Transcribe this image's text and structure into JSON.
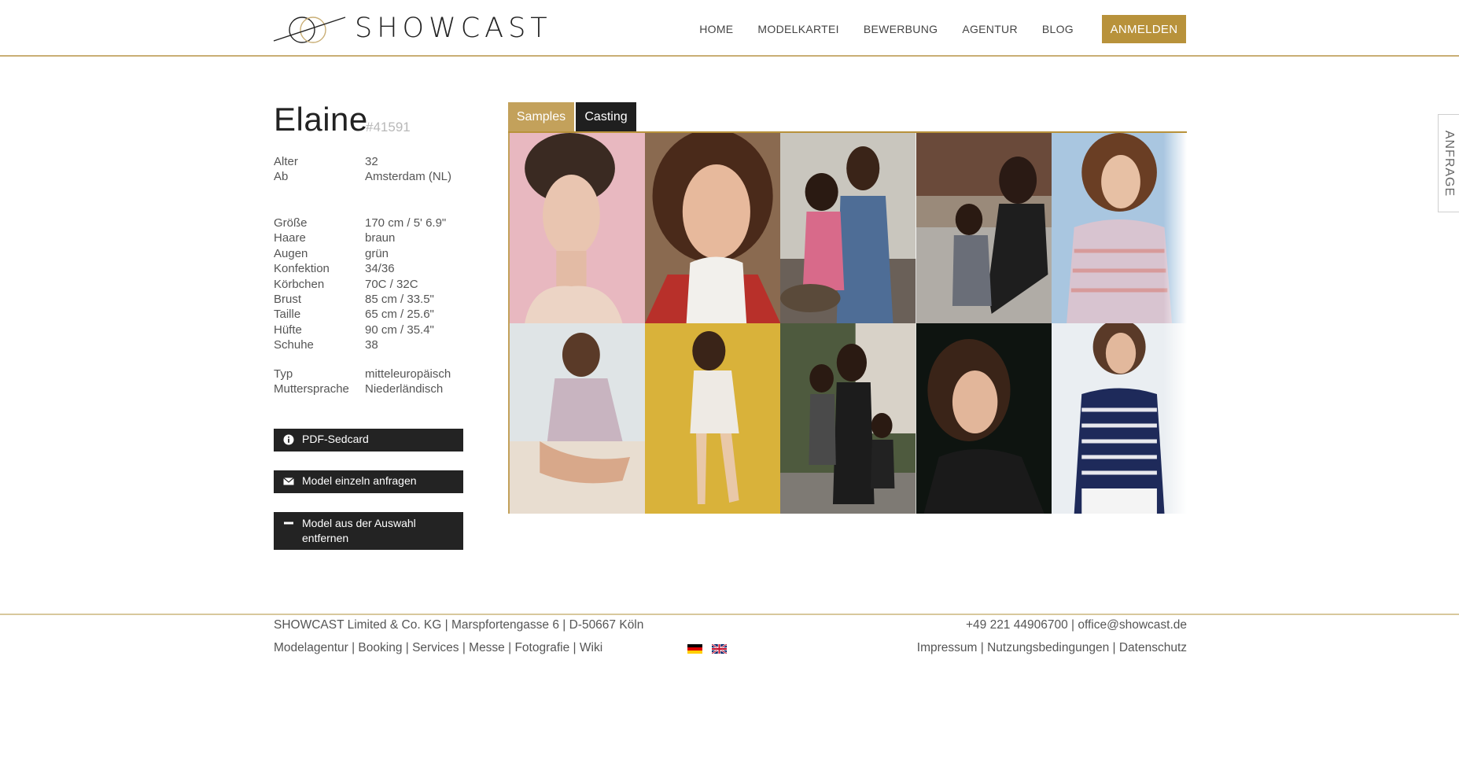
{
  "header": {
    "logo_text": "SHOWCAST",
    "nav": [
      "HOME",
      "MODELKARTEI",
      "BEWERBUNG",
      "AGENTUR",
      "BLOG"
    ],
    "login_label": "ANMELDEN"
  },
  "model": {
    "name": "Elaine",
    "id": "#41591"
  },
  "info_groups": [
    [
      {
        "label": "Alter",
        "value": "32"
      },
      {
        "label": "Ab",
        "value": "Amsterdam (NL)"
      }
    ],
    [
      {
        "label": "Größe",
        "value": "170 cm / 5' 6.9\""
      },
      {
        "label": "Haare",
        "value": "braun"
      },
      {
        "label": "Augen",
        "value": "grün"
      },
      {
        "label": "Konfektion",
        "value": "34/36"
      },
      {
        "label": "Körbchen",
        "value": "70C / 32C"
      },
      {
        "label": "Brust",
        "value": "85 cm / 33.5\""
      },
      {
        "label": "Taille",
        "value": "65 cm / 25.6\""
      },
      {
        "label": "Hüfte",
        "value": "90 cm / 35.4\""
      },
      {
        "label": "Schuhe",
        "value": "38"
      }
    ],
    [
      {
        "label": "Typ",
        "value": "mitteleuropäisch"
      },
      {
        "label": "Muttersprache",
        "value": "Niederländisch"
      }
    ]
  ],
  "actions": {
    "pdf": "PDF-Sedcard",
    "request": "Model einzeln anfragen",
    "remove": "Model aus der Auswahl entfernen"
  },
  "tabs": {
    "samples": "Samples",
    "casting": "Casting"
  },
  "side_tab": "ANFRAGE",
  "footer": {
    "address": "SHOWCAST Limited & Co. KG | Marspfortengasse 6 | D-50667 Köln",
    "contact": "+49 221 44906700 | office@showcast.de",
    "links_left": "Modelagentur | Booking | Services | Messe | Fotografie | Wiki",
    "links_right": "Impressum | Nutzungsbedingungen | Datenschutz"
  },
  "colors": {
    "accent": "#b8923b",
    "dark": "#232323"
  }
}
